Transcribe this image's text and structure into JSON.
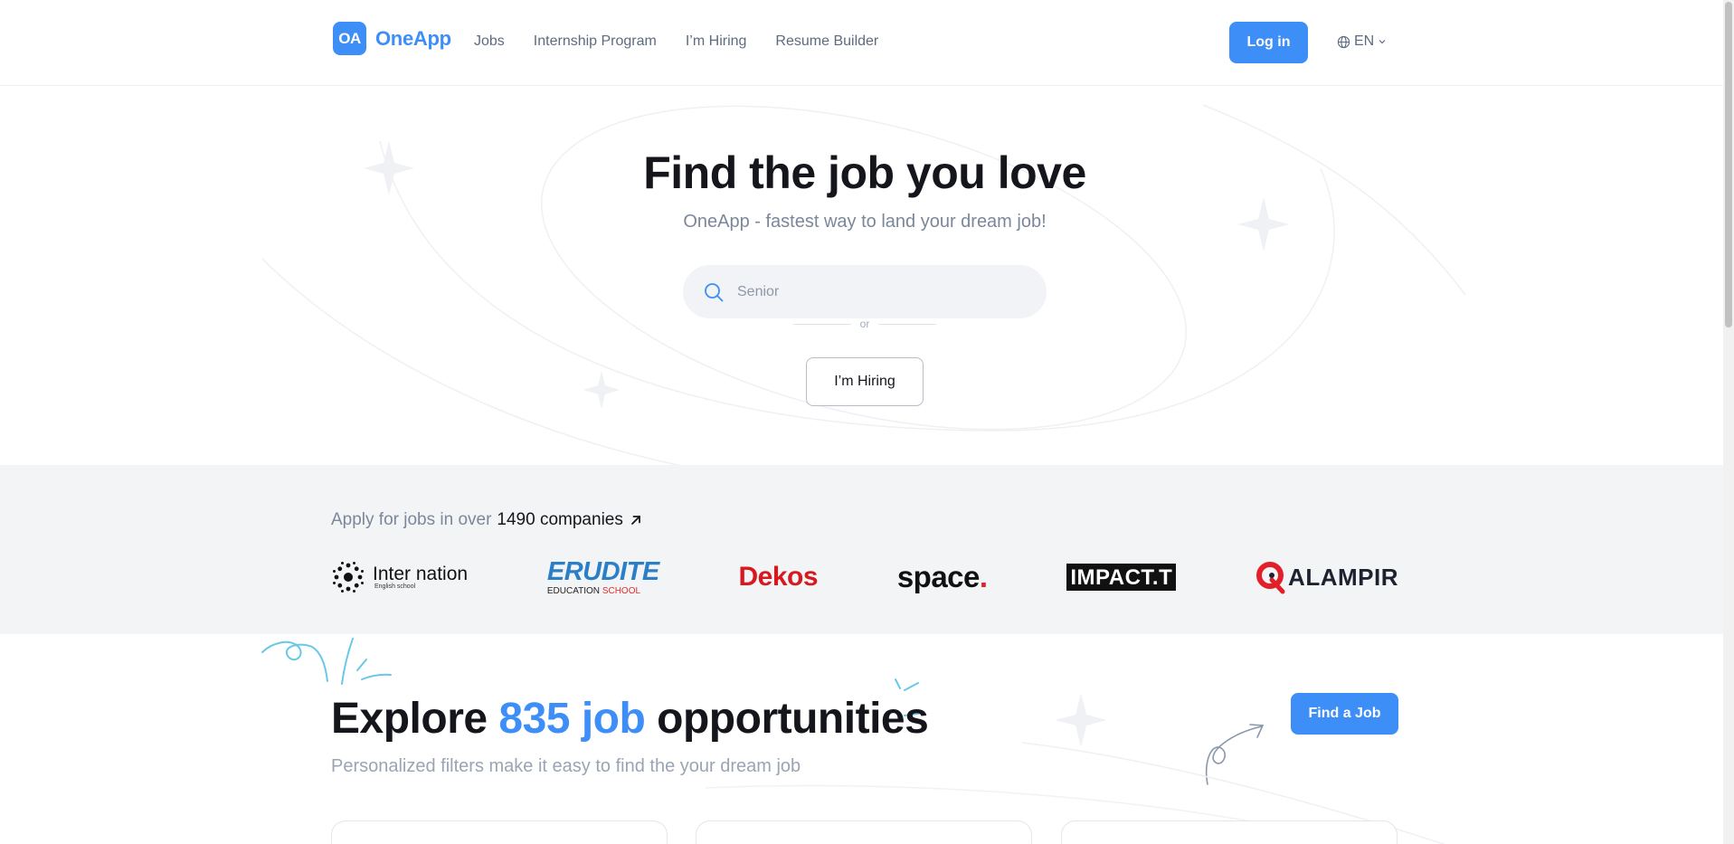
{
  "header": {
    "logo_badge": "OA",
    "logo_text": "OneApp",
    "nav": [
      "Jobs",
      "Internship Program",
      "I’m Hiring",
      "Resume Builder"
    ],
    "login_label": "Log in",
    "language": "EN"
  },
  "hero": {
    "title": "Find the job you love",
    "subtitle": "OneApp - fastest way to land your dream job!",
    "search_placeholder": "Senior",
    "or_label": "or",
    "hiring_button": "I’m Hiring"
  },
  "companies": {
    "heading_prefix": "Apply for jobs in over",
    "heading_count": "1490 companies",
    "logos": [
      {
        "name": "Inter nation",
        "tagline": "English school"
      },
      {
        "name": "ERUDITE",
        "tagline_a": "EDUCATION",
        "tagline_b": "SCHOOL"
      },
      {
        "name": "Dekos"
      },
      {
        "name": "space",
        "suffix": "."
      },
      {
        "name": "IMPACT.T"
      },
      {
        "name": "ALAMPIR"
      }
    ]
  },
  "explore": {
    "title_prefix": "Explore",
    "title_highlight": "835 job",
    "title_suffix": "opportunities",
    "subtitle": "Personalized filters make it easy to find the your dream job",
    "find_button": "Find a Job"
  },
  "colors": {
    "accent": "#3e8ef7",
    "text_dark": "#14161c",
    "text_muted": "#7b879a",
    "section_gray": "#f3f4f6"
  }
}
